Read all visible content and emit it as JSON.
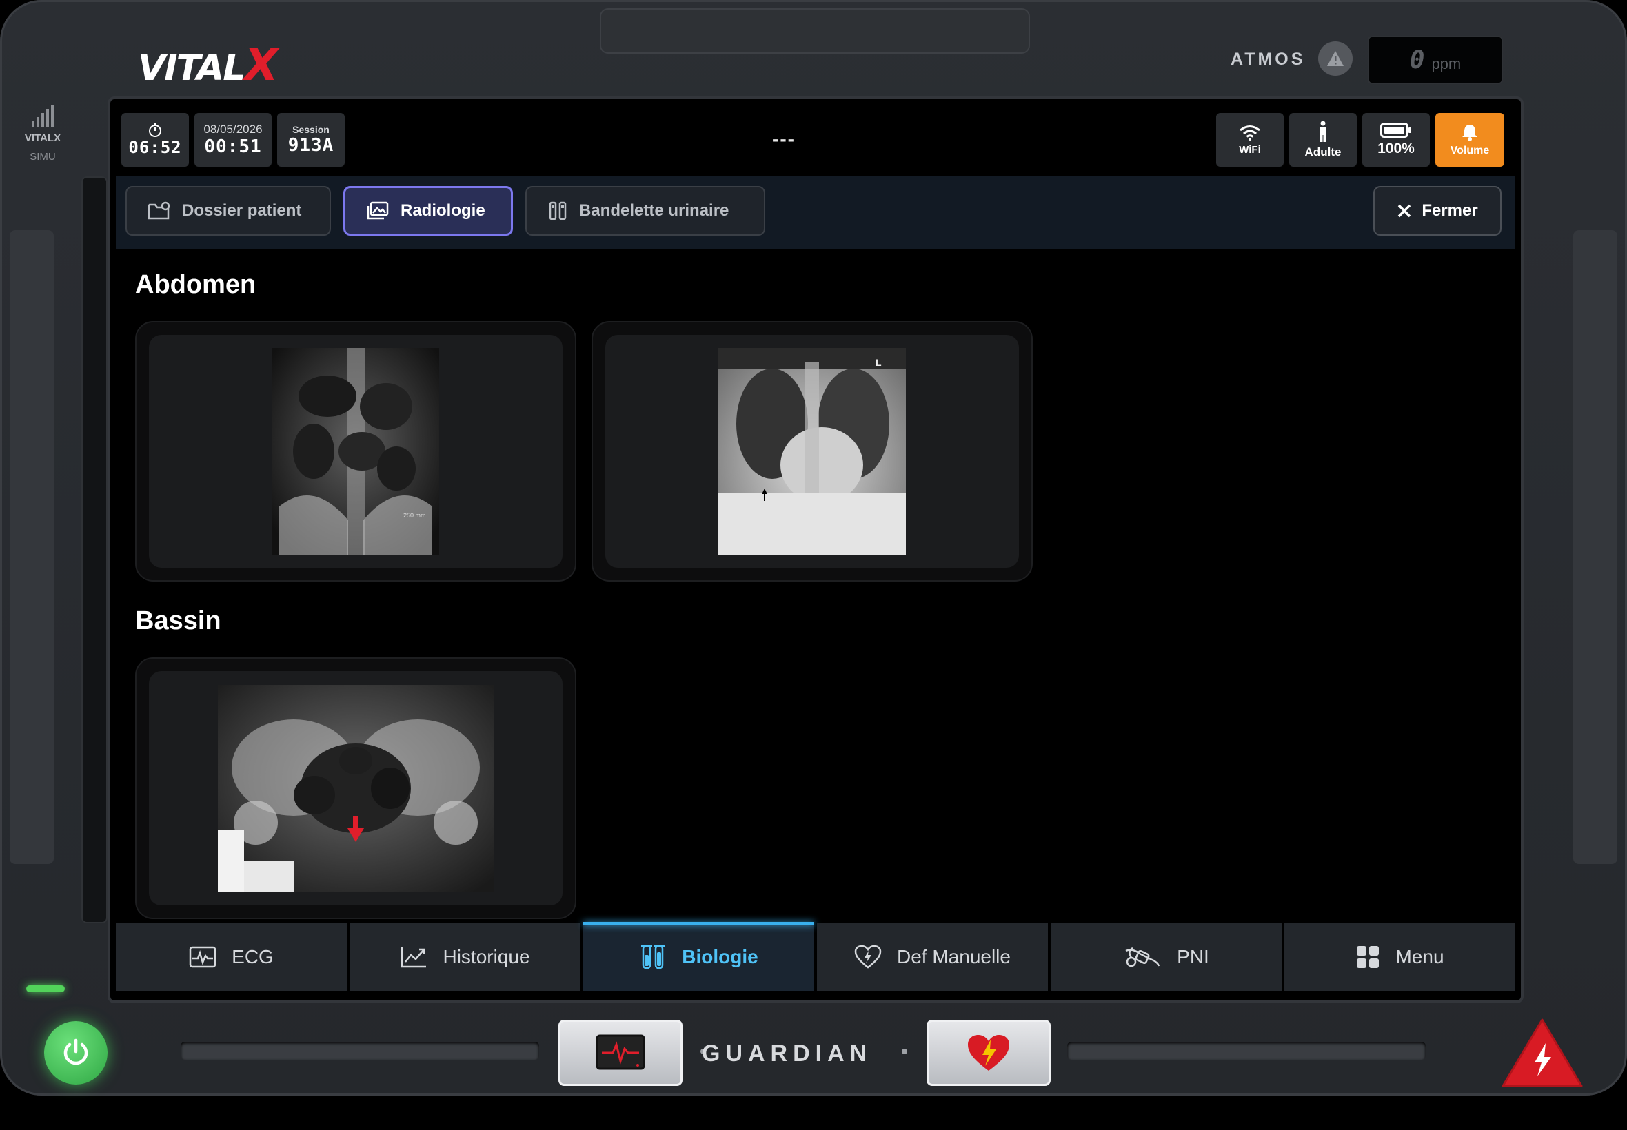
{
  "brand": {
    "logo_main": "VITAL",
    "logo_x": "X"
  },
  "atmos": {
    "label": "ATMOS",
    "ppm_value": "0",
    "ppm_unit": "ppm"
  },
  "left_panel": {
    "brand": "VITALX",
    "mode": "SIMU"
  },
  "status": {
    "timer": "06:52",
    "date": "08/05/2026",
    "time": "00:51",
    "session_label": "Session",
    "session_id": "913A",
    "center_text": "---",
    "wifi_label": "WiFi",
    "patient_label": "Adulte",
    "battery_label": "100%",
    "volume_label": "Volume"
  },
  "colors": {
    "accent_orange": "#f28c1e",
    "active_tab": "#7c78ee",
    "nav_active": "#4fc3f7",
    "power_green": "#52d35a",
    "shock_red": "#e01e2b"
  },
  "tabs": [
    {
      "label": "Dossier patient",
      "icon": "folder-user-icon",
      "active": false
    },
    {
      "label": "Radiologie",
      "icon": "images-icon",
      "active": true
    },
    {
      "label": "Bandelette urinaire",
      "icon": "test-strip-icon",
      "active": false
    }
  ],
  "close_label": "Fermer",
  "sections": [
    {
      "title": "Abdomen",
      "images": [
        "abdomen-xray-1",
        "chest-xray-2"
      ]
    },
    {
      "title": "Bassin",
      "images": [
        "pelvis-xray-1"
      ]
    }
  ],
  "xray_annotations": {
    "abdomen_scale": "250 mm",
    "chest_marker": "L"
  },
  "bottom_nav": [
    {
      "label": "ECG",
      "icon": "ecg-icon"
    },
    {
      "label": "Historique",
      "icon": "trend-chart-icon"
    },
    {
      "label": "Biologie",
      "icon": "test-tubes-icon",
      "active": true
    },
    {
      "label": "Def Manuelle",
      "icon": "heart-defib-icon"
    },
    {
      "label": "PNI",
      "icon": "blood-pressure-cuff-icon"
    },
    {
      "label": "Menu",
      "icon": "grid-menu-icon"
    }
  ],
  "hardware": {
    "center_label": "GUARDIAN"
  }
}
